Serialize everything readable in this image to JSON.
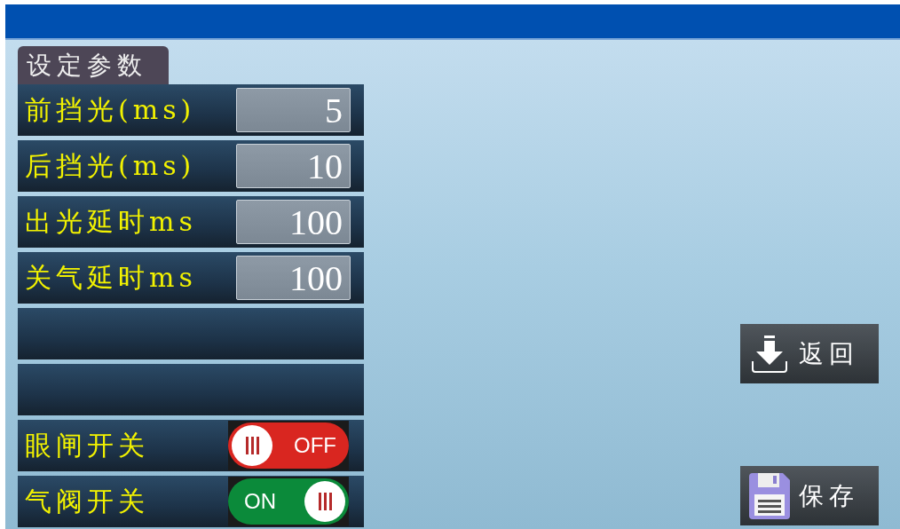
{
  "tab": {
    "label": "设定参数"
  },
  "rows": [
    {
      "kind": "number",
      "label": "前挡光(ms)",
      "value": "5"
    },
    {
      "kind": "number",
      "label": "后挡光(ms)",
      "value": "10"
    },
    {
      "kind": "number",
      "label": "出光延时ms",
      "value": "100"
    },
    {
      "kind": "number",
      "label": "关气延时ms",
      "value": "100"
    },
    {
      "kind": "empty"
    },
    {
      "kind": "empty"
    },
    {
      "kind": "toggle",
      "label": "眼闸开关",
      "on": false,
      "state_text": "OFF"
    },
    {
      "kind": "toggle",
      "label": "气阀开关",
      "on": true,
      "state_text": "ON"
    }
  ],
  "buttons": [
    {
      "kind": "back",
      "label": "返回"
    },
    {
      "kind": "save",
      "label": "保存"
    }
  ]
}
